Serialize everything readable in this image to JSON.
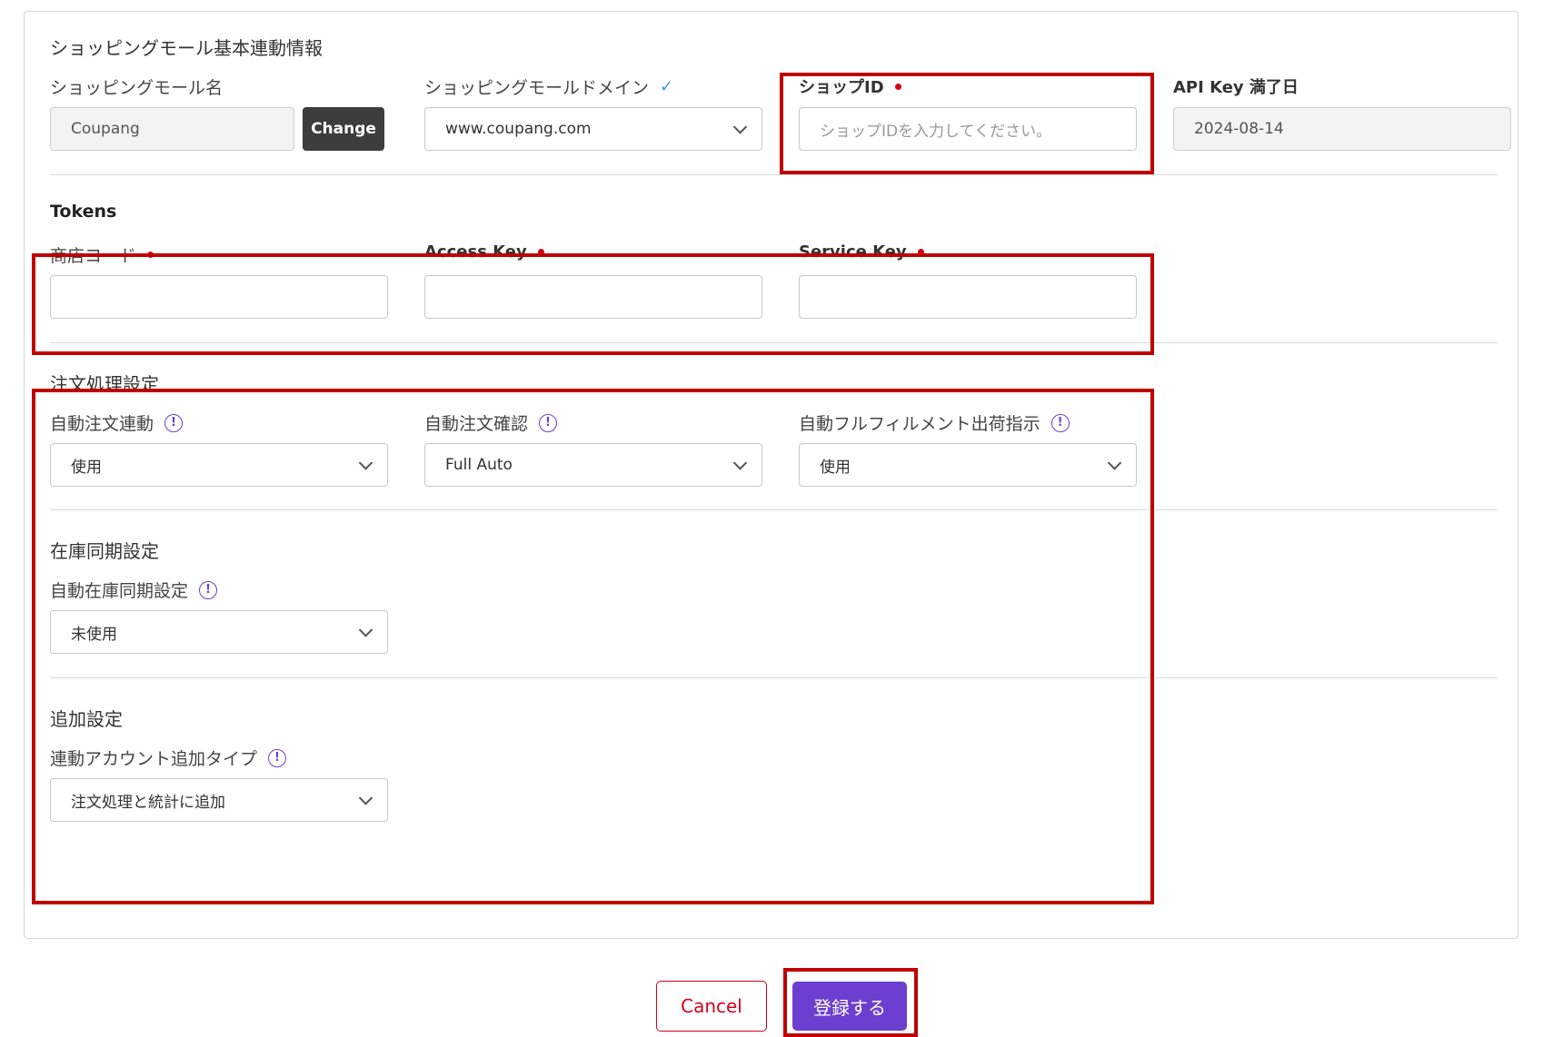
{
  "basic": {
    "title": "ショッピングモール基本連動情報",
    "mall_name_label": "ショッピングモール名",
    "mall_name_value": "Coupang",
    "change_label": "Change",
    "domain_label": "ショッピングモールドメイン",
    "domain_value": "www.coupang.com",
    "shop_id_label": "ショップID",
    "shop_id_placeholder": "ショップIDを入力してください。",
    "api_key_label": "API Key 満了日",
    "api_key_value": "2024-08-14"
  },
  "tokens": {
    "title": "Tokens",
    "store_code_label": "商店コード",
    "access_key_label": "Access Key",
    "service_key_label": "Service Key"
  },
  "order": {
    "title": "注文処理設定",
    "auto_link_label": "自動注文連動",
    "auto_link_value": "使用",
    "auto_confirm_label": "自動注文確認",
    "auto_confirm_value": "Full Auto",
    "auto_fulfill_label": "自動フルフィルメント出荷指示",
    "auto_fulfill_value": "使用"
  },
  "inventory": {
    "title": "在庫同期設定",
    "auto_sync_label": "自動在庫同期設定",
    "auto_sync_value": "未使用"
  },
  "extra": {
    "title": "追加設定",
    "account_type_label": "連動アカウント追加タイプ",
    "account_type_value": "注文処理と統計に追加"
  },
  "actions": {
    "cancel_label": "Cancel",
    "submit_label": "登録する"
  },
  "colors": {
    "accent": "#6c3fd1",
    "required": "#d0021b",
    "highlight": "#c00000"
  }
}
